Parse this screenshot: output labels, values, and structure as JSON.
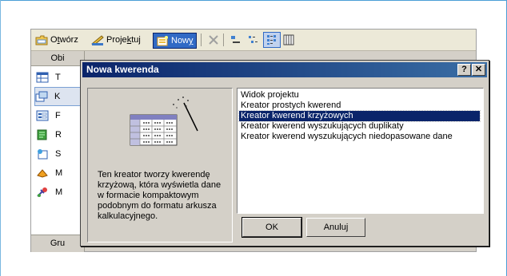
{
  "toolbar": {
    "open_label_pre": "O",
    "open_label_u": "t",
    "open_label_post": "wórz",
    "design_label_pre": "Proje",
    "design_label_u": "k",
    "design_label_post": "tuj",
    "new_label_pre": "Now",
    "new_label_u": "y"
  },
  "objects_pane": {
    "header": "Obi",
    "items": [
      {
        "letter": "T",
        "icon": "table-icon"
      },
      {
        "letter": "K",
        "icon": "query-icon"
      },
      {
        "letter": "F",
        "icon": "form-icon"
      },
      {
        "letter": "R",
        "icon": "report-icon"
      },
      {
        "letter": "S",
        "icon": "page-icon"
      },
      {
        "letter": "M",
        "icon": "macro-icon"
      },
      {
        "letter": "M",
        "icon": "module-icon"
      }
    ],
    "groups": "Gru"
  },
  "dialog": {
    "title": "Nowa kwerenda",
    "help_button": "?",
    "close_button": "✕",
    "description": "Ten kreator tworzy kwerendę krzyżową, która wyświetla dane w formacie kompaktowym podobnym do formatu arkusza kalkulacyjnego.",
    "options": [
      "Widok projektu",
      "Kreator prostych kwerend",
      "Kreator kwerend krzyżowych",
      "Kreator kwerend wyszukujących duplikaty",
      "Kreator kwerend wyszukujących niedopasowane dane"
    ],
    "selected_index": 2,
    "ok_label": "OK",
    "cancel_label": "Anuluj"
  },
  "colors": {
    "titlebar_start": "#0a246a",
    "titlebar_end": "#3a6ea5",
    "selection": "#0a246a",
    "frame": "#4a9ed6"
  }
}
